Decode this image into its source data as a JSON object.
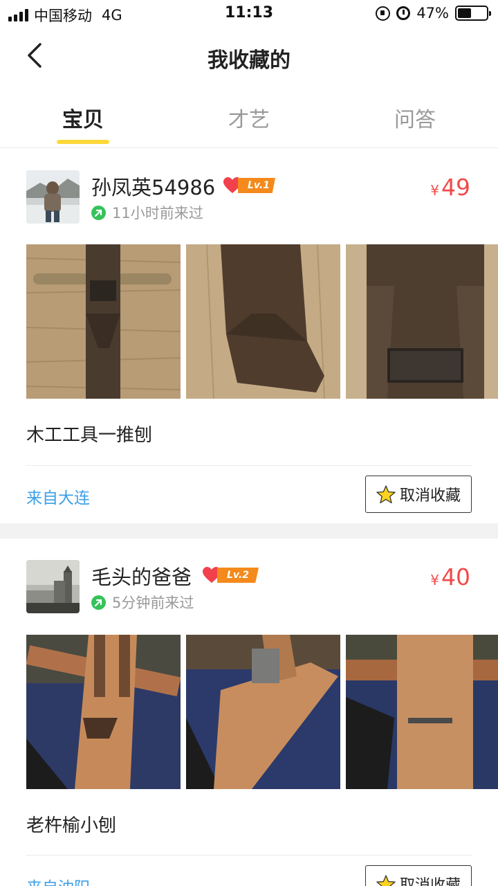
{
  "status_bar": {
    "carrier": "中国移动",
    "network": "4G",
    "time": "11:13",
    "battery": "47%",
    "battery_level": 0.47
  },
  "header": {
    "title": "我收藏的"
  },
  "tabs": [
    {
      "label": "宝贝",
      "active": true
    },
    {
      "label": "才艺",
      "active": false
    },
    {
      "label": "问答",
      "active": false
    }
  ],
  "items": [
    {
      "user": "孙凤英54986",
      "level": "Lv.1",
      "last_seen": "11小时前来过",
      "currency": "¥",
      "price": "49",
      "title": "木工工具一推刨",
      "location": "来自大连",
      "unfav_label": "取消收藏"
    },
    {
      "user": "毛头的爸爸",
      "level": "Lv.2",
      "last_seen": "5分钟前来过",
      "currency": "¥",
      "price": "40",
      "title": "老杵榆小刨",
      "location": "来自沈阳",
      "unfav_label": "取消收藏"
    }
  ],
  "colors": {
    "accent_yellow": "#ffd83b",
    "price_red": "#f24a4a",
    "location_blue": "#3aa0e8",
    "online_green": "#35c25a",
    "level_orange": "#f48a1c"
  }
}
